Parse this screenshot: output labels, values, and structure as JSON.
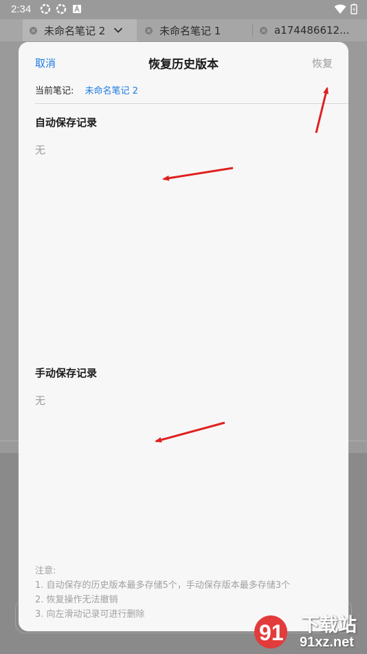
{
  "status_bar": {
    "time": "2:34"
  },
  "tabs": [
    {
      "label": "未命名笔记 2",
      "active": true
    },
    {
      "label": "未命名笔记 1",
      "active": false
    },
    {
      "label": "a174486612...",
      "active": false
    }
  ],
  "dialog": {
    "cancel_label": "取消",
    "title": "恢复历史版本",
    "restore_label": "恢复",
    "current_note_label": "当前笔记:",
    "current_note_name": "未命名笔记 2",
    "auto_save": {
      "title": "自动保存记录",
      "empty_text": "无"
    },
    "manual_save": {
      "title": "手动保存记录",
      "empty_text": "无"
    },
    "notes": {
      "heading": "注意:",
      "lines": [
        "1. 自动保存的历史版本最多存储5个，手动保存版本最多存储3个",
        "2. 恢复操作无法撤销",
        "3. 向左滑动记录可进行删除"
      ]
    }
  },
  "watermark": {
    "brand": "下载站",
    "domain": "91xz.net",
    "logo_text": "91"
  },
  "colors": {
    "accent_blue": "#1e7be0",
    "arrow_red": "#e0201e",
    "watermark_red": "#e23b3b"
  }
}
